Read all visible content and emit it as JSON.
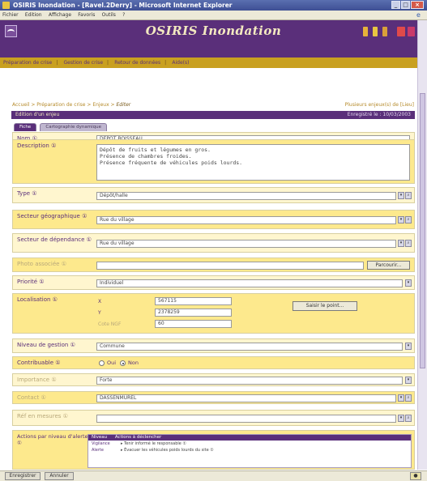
{
  "window": {
    "title": "OSIRIS Inondation - [Ravel.2Derry] - Microsoft Internet Explorer",
    "menu": [
      "Fichier",
      "Edition",
      "Affichage",
      "Favoris",
      "Outils",
      "?"
    ]
  },
  "app": {
    "title": "OSIRIS Inondation"
  },
  "nav": {
    "items": [
      "Préparation de crise",
      "Gestion de crise",
      "Retour de données",
      "Aide(s)"
    ]
  },
  "breadcrumb": {
    "prefix": "Accueil > Préparation de crise > Enjeux > ",
    "current": "Editer"
  },
  "top_link": "Plusieurs enjeux(s) de [Lieu]",
  "edit_header": {
    "title": "Edition d'un enjeu",
    "meta": "Enregistré le : 10/03/2003"
  },
  "tabs": {
    "fiche": "Fiche",
    "carto": "Cartographie dynamique"
  },
  "form": {
    "nom": {
      "label": "Nom ①",
      "value": "DEPOT BOISSEAU"
    },
    "description": {
      "label": "Description ①",
      "value": "Dépôt de fruits et légumes en gros.\nPrésence de chambres froides.\nPrésence fréquente de véhicules poids lourds."
    },
    "type": {
      "label": "Type ①",
      "value": "Dépôt/halle"
    },
    "secteur": {
      "label": "Secteur géographique ①",
      "value": "Rue du village"
    },
    "secteur_dependance": {
      "label": "Secteur de dépendance ①",
      "value": "Rue du village"
    },
    "photo": {
      "label": "Photo associée ①",
      "value": "",
      "button": "Parcourir..."
    },
    "priorite": {
      "label": "Priorité ①",
      "value": "Individuel"
    },
    "localisation": {
      "label": "Localisation ①",
      "x_label": "X",
      "x_value": "567115",
      "y_label": "Y",
      "y_value": "2378259",
      "z_label": "Cote NGF",
      "z_value": "60",
      "button": "Saisir le point..."
    },
    "niveau_gestion": {
      "label": "Niveau de gestion ①",
      "value": "Commune"
    },
    "contribuable": {
      "label": "Contribuable ①",
      "opt_yes": "Oui",
      "opt_no": "Non"
    },
    "importance": {
      "label": "Importance ①",
      "value": "Forte"
    },
    "contact": {
      "label": "Contact ①",
      "value": "DASSENMUREL"
    },
    "ref_mesures": {
      "label": "Réf en mesures ①",
      "value": ""
    },
    "actions": {
      "label": "Actions par niveau d'alerte ①",
      "head": [
        "Niveau",
        "Actions à déclencher"
      ],
      "rows": [
        {
          "level": "Vigilance",
          "text": "▸ Tenir informé le responsable ①"
        },
        {
          "level": "Alerte",
          "text": "▸ Évacuer les véhicules poids lourds du site ①"
        }
      ]
    }
  },
  "status": {
    "b1": "Enregistrer",
    "b2": "Annuler"
  }
}
